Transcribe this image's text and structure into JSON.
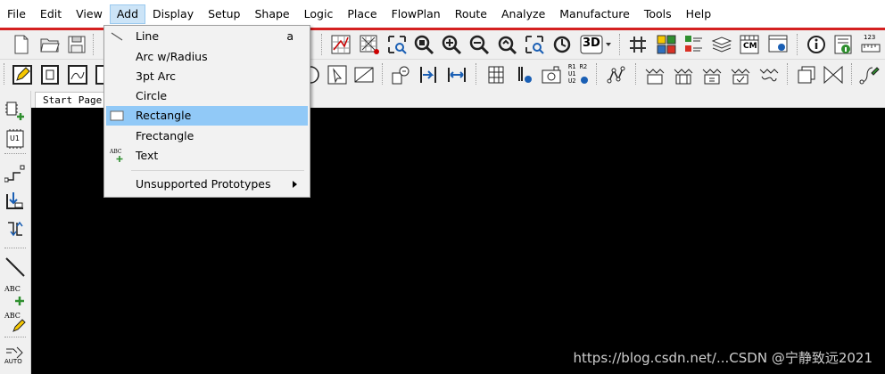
{
  "menubar": {
    "items": [
      "File",
      "Edit",
      "View",
      "Add",
      "Display",
      "Setup",
      "Shape",
      "Logic",
      "Place",
      "FlowPlan",
      "Route",
      "Analyze",
      "Manufacture",
      "Tools",
      "Help"
    ],
    "active_index": 3
  },
  "add_menu": {
    "items": [
      {
        "label": "Line",
        "shortcut": "a",
        "icon": "line-icon"
      },
      {
        "label": "Arc w/Radius",
        "shortcut": "",
        "icon": ""
      },
      {
        "label": "3pt Arc",
        "shortcut": "",
        "icon": ""
      },
      {
        "label": "Circle",
        "shortcut": "",
        "icon": ""
      },
      {
        "label": "Rectangle",
        "shortcut": "",
        "icon": "rectangle-icon",
        "highlighted": true
      },
      {
        "label": "Frectangle",
        "shortcut": "",
        "icon": ""
      },
      {
        "label": "Text",
        "shortcut": "",
        "icon": "text-add-icon"
      }
    ],
    "submenu": {
      "label": "Unsupported Prototypes"
    }
  },
  "toolbar1": {
    "icons": [
      "new-file-icon",
      "open-folder-icon",
      "save-icon",
      "grid-zoom-icon",
      "grid-edit-icon",
      "zoom-fit-icon",
      "zoom-extents-icon",
      "zoom-in-icon",
      "zoom-out-icon",
      "zoom-previous-icon",
      "zoom-world-icon",
      "refresh-icon",
      "3d-view-icon",
      "grid-icon",
      "color-palette-icon",
      "layers-icon",
      "stack-icon",
      "cm-constraint-icon",
      "settings-window-icon",
      "info-icon",
      "status-icon",
      "measure-icon"
    ],
    "label_3d": "3D",
    "label_cm": "CM",
    "label_measure": "123"
  },
  "toolbar2": {
    "icons": [
      "edit-pencil-icon",
      "move-icon",
      "mirror-icon",
      "rotate-icon",
      "circle-icon",
      "select-icon",
      "slide-icon",
      "via-icon",
      "align-left-icon",
      "dimension-icon",
      "padstack-icon",
      "pin-settings-icon",
      "camera-icon",
      "rename-refdes-icon",
      "connect-icon",
      "fanout-icon",
      "bundle-icon",
      "component-icon",
      "check-icon",
      "route-icon",
      "copy-icon",
      "bowtie-icon",
      "wire-pen-icon"
    ],
    "label_refdes": "R1 R2\nU1\nU2"
  },
  "left_toolbar": {
    "icons": [
      "add-component-icon",
      "u1-component-icon",
      "connect-pin-icon",
      "place-down-icon",
      "swap-pins-icon",
      "line-draw-icon",
      "add-text-icon",
      "edit-text-icon",
      "auto-route-icon"
    ],
    "label_u1": "U1",
    "label_abc": "ABC",
    "label_auto": "AUTO"
  },
  "tabs": {
    "start_page": "Start Page"
  },
  "watermark": "https://blog.csdn.net/...CSDN @宁静致远2021",
  "colors": {
    "accent_red": "#d42020",
    "highlight": "#91c9f7",
    "canvas": "#000000"
  }
}
